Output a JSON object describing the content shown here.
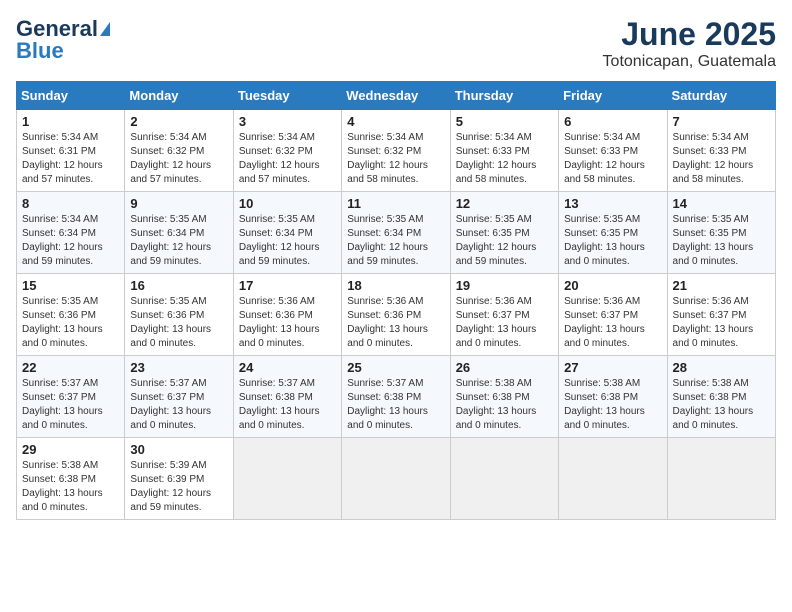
{
  "header": {
    "logo_general": "General",
    "logo_blue": "Blue",
    "title": "June 2025",
    "subtitle": "Totonicapan, Guatemala"
  },
  "weekdays": [
    "Sunday",
    "Monday",
    "Tuesday",
    "Wednesday",
    "Thursday",
    "Friday",
    "Saturday"
  ],
  "weeks": [
    [
      {
        "day": "1",
        "sunrise": "5:34 AM",
        "sunset": "6:31 PM",
        "daylight": "12 hours and 57 minutes."
      },
      {
        "day": "2",
        "sunrise": "5:34 AM",
        "sunset": "6:32 PM",
        "daylight": "12 hours and 57 minutes."
      },
      {
        "day": "3",
        "sunrise": "5:34 AM",
        "sunset": "6:32 PM",
        "daylight": "12 hours and 57 minutes."
      },
      {
        "day": "4",
        "sunrise": "5:34 AM",
        "sunset": "6:32 PM",
        "daylight": "12 hours and 58 minutes."
      },
      {
        "day": "5",
        "sunrise": "5:34 AM",
        "sunset": "6:33 PM",
        "daylight": "12 hours and 58 minutes."
      },
      {
        "day": "6",
        "sunrise": "5:34 AM",
        "sunset": "6:33 PM",
        "daylight": "12 hours and 58 minutes."
      },
      {
        "day": "7",
        "sunrise": "5:34 AM",
        "sunset": "6:33 PM",
        "daylight": "12 hours and 58 minutes."
      }
    ],
    [
      {
        "day": "8",
        "sunrise": "5:34 AM",
        "sunset": "6:34 PM",
        "daylight": "12 hours and 59 minutes."
      },
      {
        "day": "9",
        "sunrise": "5:35 AM",
        "sunset": "6:34 PM",
        "daylight": "12 hours and 59 minutes."
      },
      {
        "day": "10",
        "sunrise": "5:35 AM",
        "sunset": "6:34 PM",
        "daylight": "12 hours and 59 minutes."
      },
      {
        "day": "11",
        "sunrise": "5:35 AM",
        "sunset": "6:34 PM",
        "daylight": "12 hours and 59 minutes."
      },
      {
        "day": "12",
        "sunrise": "5:35 AM",
        "sunset": "6:35 PM",
        "daylight": "12 hours and 59 minutes."
      },
      {
        "day": "13",
        "sunrise": "5:35 AM",
        "sunset": "6:35 PM",
        "daylight": "13 hours and 0 minutes."
      },
      {
        "day": "14",
        "sunrise": "5:35 AM",
        "sunset": "6:35 PM",
        "daylight": "13 hours and 0 minutes."
      }
    ],
    [
      {
        "day": "15",
        "sunrise": "5:35 AM",
        "sunset": "6:36 PM",
        "daylight": "13 hours and 0 minutes."
      },
      {
        "day": "16",
        "sunrise": "5:35 AM",
        "sunset": "6:36 PM",
        "daylight": "13 hours and 0 minutes."
      },
      {
        "day": "17",
        "sunrise": "5:36 AM",
        "sunset": "6:36 PM",
        "daylight": "13 hours and 0 minutes."
      },
      {
        "day": "18",
        "sunrise": "5:36 AM",
        "sunset": "6:36 PM",
        "daylight": "13 hours and 0 minutes."
      },
      {
        "day": "19",
        "sunrise": "5:36 AM",
        "sunset": "6:37 PM",
        "daylight": "13 hours and 0 minutes."
      },
      {
        "day": "20",
        "sunrise": "5:36 AM",
        "sunset": "6:37 PM",
        "daylight": "13 hours and 0 minutes."
      },
      {
        "day": "21",
        "sunrise": "5:36 AM",
        "sunset": "6:37 PM",
        "daylight": "13 hours and 0 minutes."
      }
    ],
    [
      {
        "day": "22",
        "sunrise": "5:37 AM",
        "sunset": "6:37 PM",
        "daylight": "13 hours and 0 minutes."
      },
      {
        "day": "23",
        "sunrise": "5:37 AM",
        "sunset": "6:37 PM",
        "daylight": "13 hours and 0 minutes."
      },
      {
        "day": "24",
        "sunrise": "5:37 AM",
        "sunset": "6:38 PM",
        "daylight": "13 hours and 0 minutes."
      },
      {
        "day": "25",
        "sunrise": "5:37 AM",
        "sunset": "6:38 PM",
        "daylight": "13 hours and 0 minutes."
      },
      {
        "day": "26",
        "sunrise": "5:38 AM",
        "sunset": "6:38 PM",
        "daylight": "13 hours and 0 minutes."
      },
      {
        "day": "27",
        "sunrise": "5:38 AM",
        "sunset": "6:38 PM",
        "daylight": "13 hours and 0 minutes."
      },
      {
        "day": "28",
        "sunrise": "5:38 AM",
        "sunset": "6:38 PM",
        "daylight": "13 hours and 0 minutes."
      }
    ],
    [
      {
        "day": "29",
        "sunrise": "5:38 AM",
        "sunset": "6:38 PM",
        "daylight": "13 hours and 0 minutes."
      },
      {
        "day": "30",
        "sunrise": "5:39 AM",
        "sunset": "6:39 PM",
        "daylight": "12 hours and 59 minutes."
      },
      null,
      null,
      null,
      null,
      null
    ]
  ]
}
